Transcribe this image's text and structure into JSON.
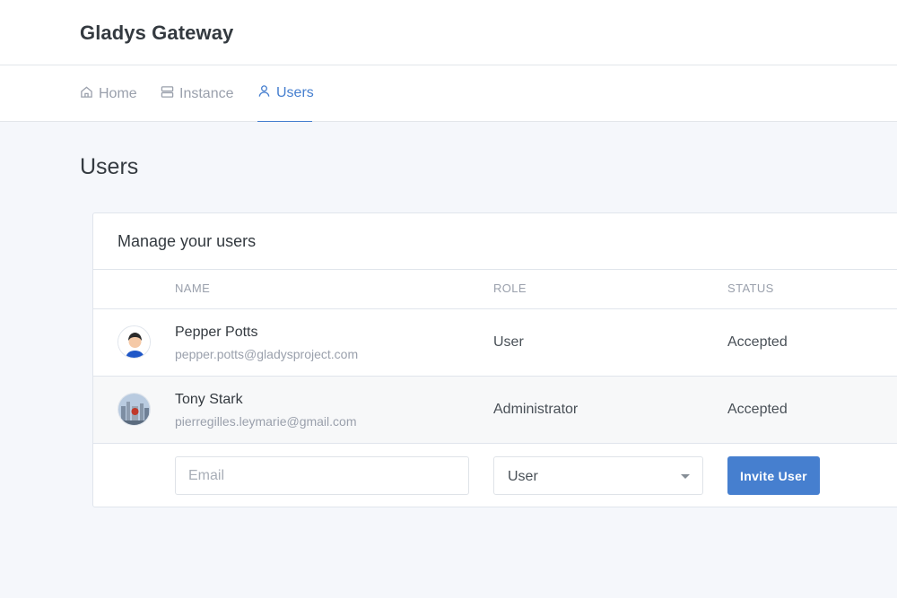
{
  "header": {
    "brand": "Gladys Gateway"
  },
  "nav": {
    "items": [
      {
        "label": "Home",
        "icon": "home-icon",
        "active": false
      },
      {
        "label": "Instance",
        "icon": "server-icon",
        "active": false
      },
      {
        "label": "Users",
        "icon": "user-icon",
        "active": true
      }
    ]
  },
  "page": {
    "title": "Users"
  },
  "card": {
    "title": "Manage your users",
    "columns": [
      "NAME",
      "ROLE",
      "STATUS"
    ],
    "users": [
      {
        "name": "Pepper Potts",
        "email": "pepper.potts@gladysproject.com",
        "role": "User",
        "status": "Accepted"
      },
      {
        "name": "Tony Stark",
        "email": "pierregilles.leymarie@gmail.com",
        "role": "Administrator",
        "status": "Accepted"
      }
    ],
    "invite": {
      "email_placeholder": "Email",
      "role_value": "User",
      "button_label": "Invite User"
    }
  },
  "colors": {
    "accent": "#467fcf",
    "background": "#f5f7fb"
  }
}
